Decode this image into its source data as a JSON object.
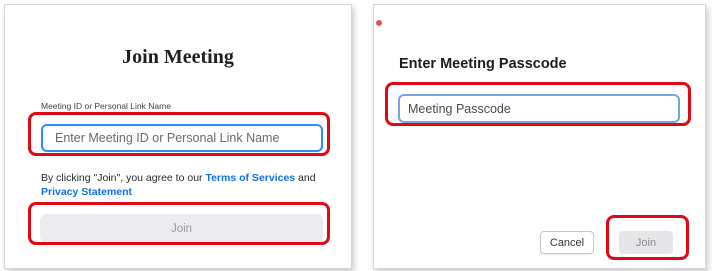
{
  "left": {
    "title": "Join Meeting",
    "field_label": "Meeting ID or Personal Link Name",
    "input_placeholder": "Enter Meeting ID or Personal Link Name",
    "terms_prefix": "By clicking \"Join\", you agree to our ",
    "terms_link": "Terms of Services",
    "terms_and": " and",
    "privacy_link": "Privacy Statement",
    "join_label": "Join"
  },
  "right": {
    "title": "Enter Meeting Passcode",
    "input_placeholder": "Meeting Passcode",
    "cancel_label": "Cancel",
    "join_label": "Join"
  },
  "colors": {
    "annotation": "#e30613",
    "accent_blue": "#2d8cff",
    "link_blue": "#0e72ed"
  }
}
